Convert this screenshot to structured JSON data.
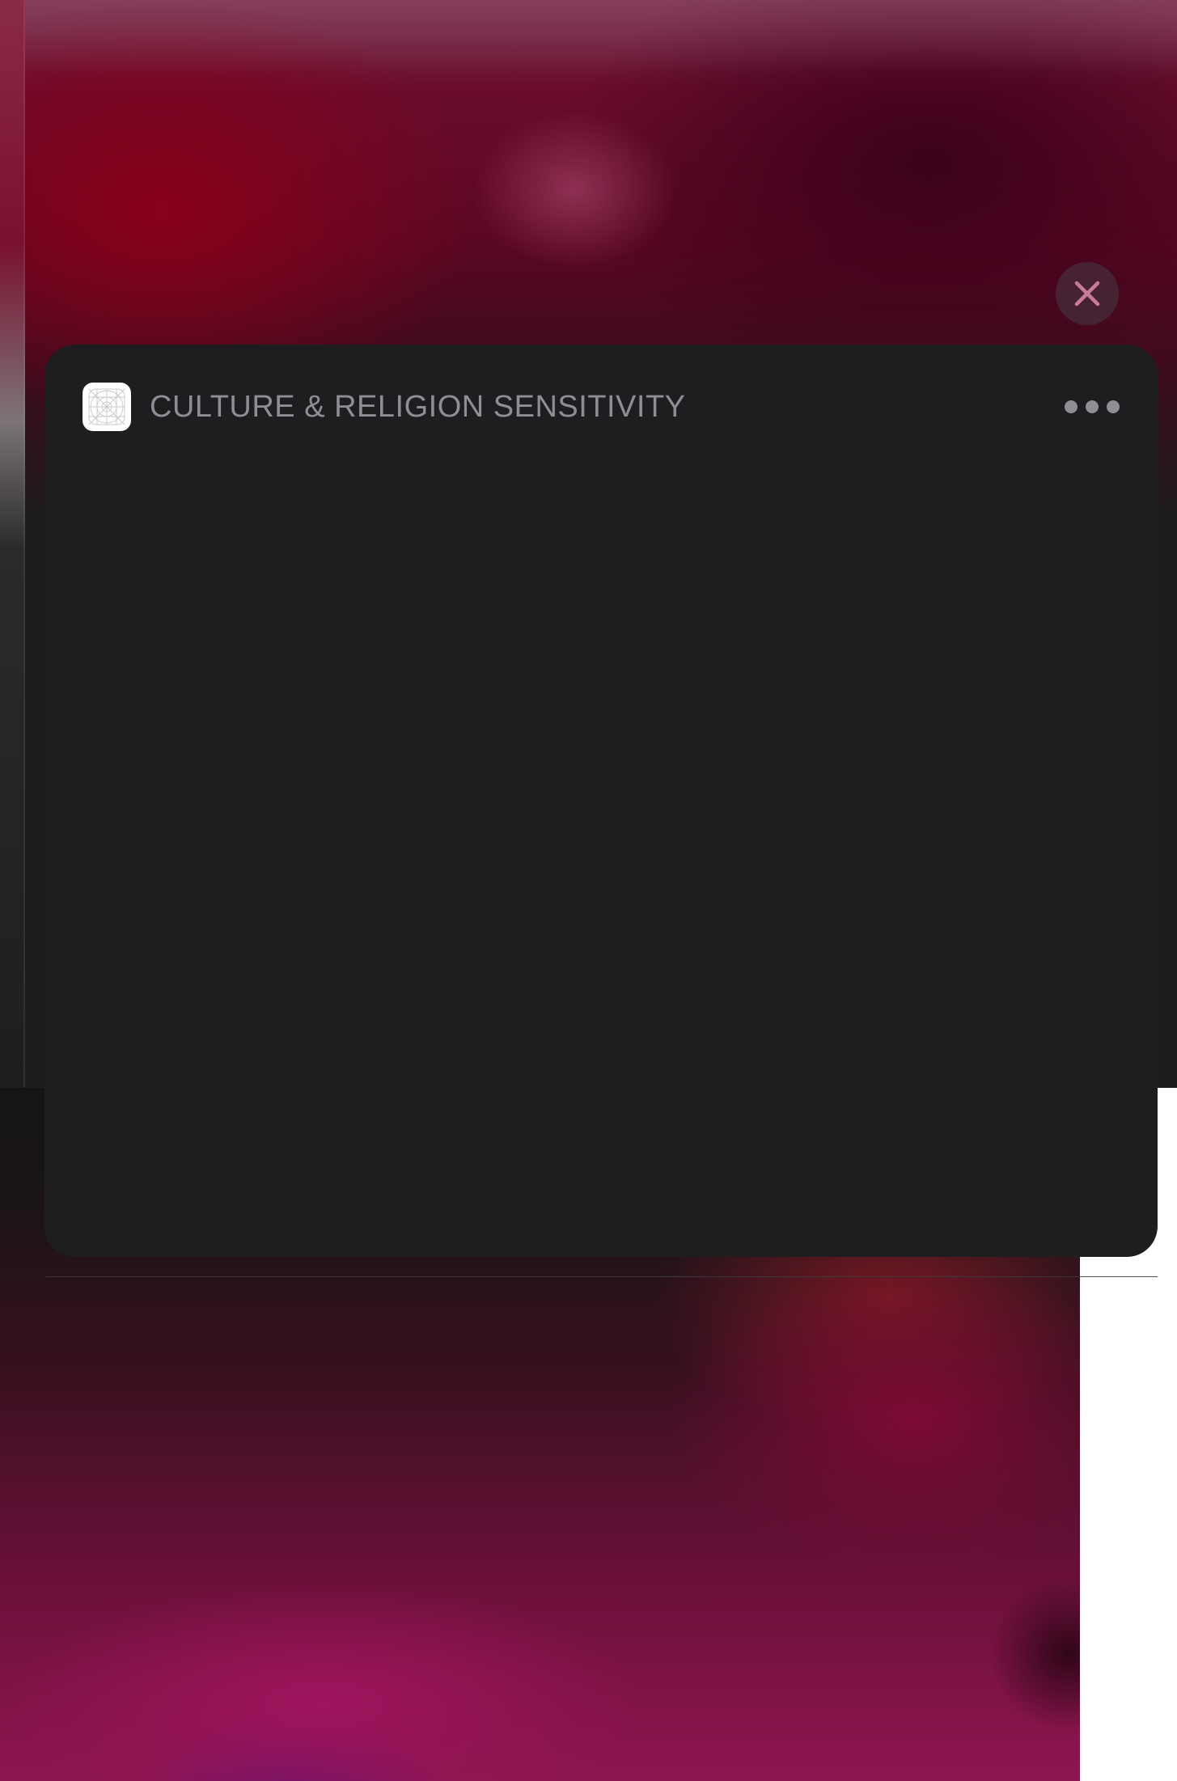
{
  "widget": {
    "title": "CULTURE & RELIGION SENSITIVITY",
    "app_icon": "app-placeholder-icon",
    "more_icon": "ellipsis-icon"
  },
  "close": {
    "icon": "close-icon",
    "color": "#c97a9a"
  },
  "colors": {
    "card_background": "#1e1e20",
    "title_text": "#8e8e93"
  }
}
